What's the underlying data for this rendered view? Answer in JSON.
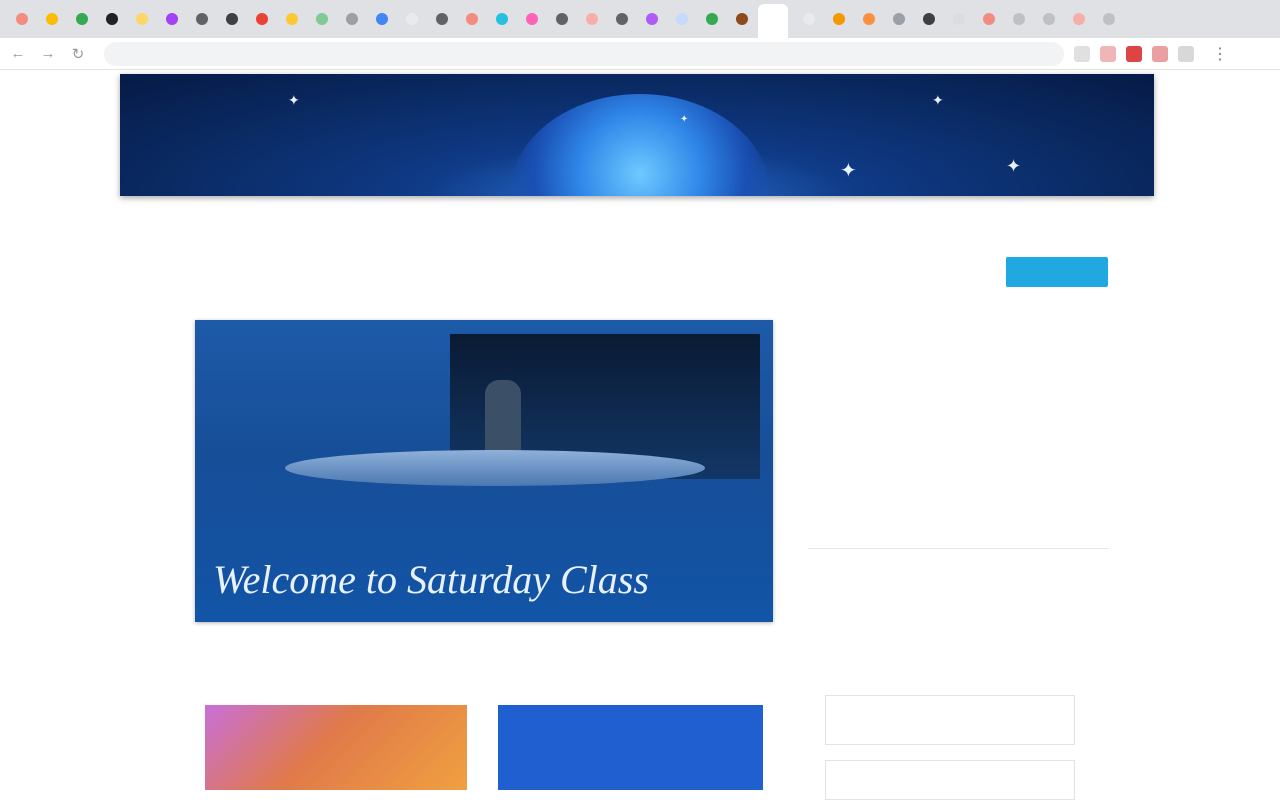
{
  "browser": {
    "tabs": [
      {
        "color": "#f28b82"
      },
      {
        "color": "#fbbc04"
      },
      {
        "color": "#34a853"
      },
      {
        "color": "#202124"
      },
      {
        "color": "#fdd663"
      },
      {
        "color": "#a142f4"
      },
      {
        "color": "#5f6368"
      },
      {
        "color": "#3c4043"
      },
      {
        "color": "#ea4335"
      },
      {
        "color": "#fcc934"
      },
      {
        "color": "#81c995"
      },
      {
        "color": "#9aa0a6"
      },
      {
        "color": "#4285f4"
      },
      {
        "color": "#e8eaed"
      },
      {
        "color": "#5f6368"
      },
      {
        "color": "#f28b82"
      },
      {
        "color": "#24c1e0"
      },
      {
        "color": "#ff63b8"
      },
      {
        "color": "#5f6368"
      },
      {
        "color": "#f6aea9"
      },
      {
        "color": "#5f6368"
      },
      {
        "color": "#af5cf7"
      },
      {
        "color": "#c6dafc"
      },
      {
        "color": "#34a853"
      },
      {
        "color": "#8d4a1a"
      }
    ],
    "tabs_right": [
      {
        "color": "#e8eaed"
      },
      {
        "color": "#f29900"
      },
      {
        "color": "#fa903e"
      },
      {
        "color": "#9aa0a6"
      },
      {
        "color": "#3c4043"
      },
      {
        "color": "#dadce0"
      },
      {
        "color": "#f28b82"
      },
      {
        "color": "#bdc1c6"
      },
      {
        "color": "#bdc1c6"
      },
      {
        "color": "#f6aea9"
      },
      {
        "color": "#bdc1c6"
      }
    ],
    "back_icon": "arrow-left-icon",
    "forward_icon": "arrow-right-icon",
    "reload_icon": "reload-icon",
    "url": "",
    "menu_icon": "kebab-menu-icon"
  },
  "site": {
    "banner_left_text": "",
    "banner_right_text": "",
    "nav_items": [],
    "subscribe_label": ""
  },
  "hero": {
    "title": "Welcome to Saturday Class"
  },
  "section_label": "",
  "cards": {
    "right_year": "",
    "right_subtitle": ""
  },
  "sidebar": {
    "kicker": "",
    "title": "",
    "field1": "",
    "field2": ""
  },
  "colors": {
    "banner": "#0a2a63",
    "accent": "#20a8e0",
    "card_blue": "#1f5fd0"
  }
}
